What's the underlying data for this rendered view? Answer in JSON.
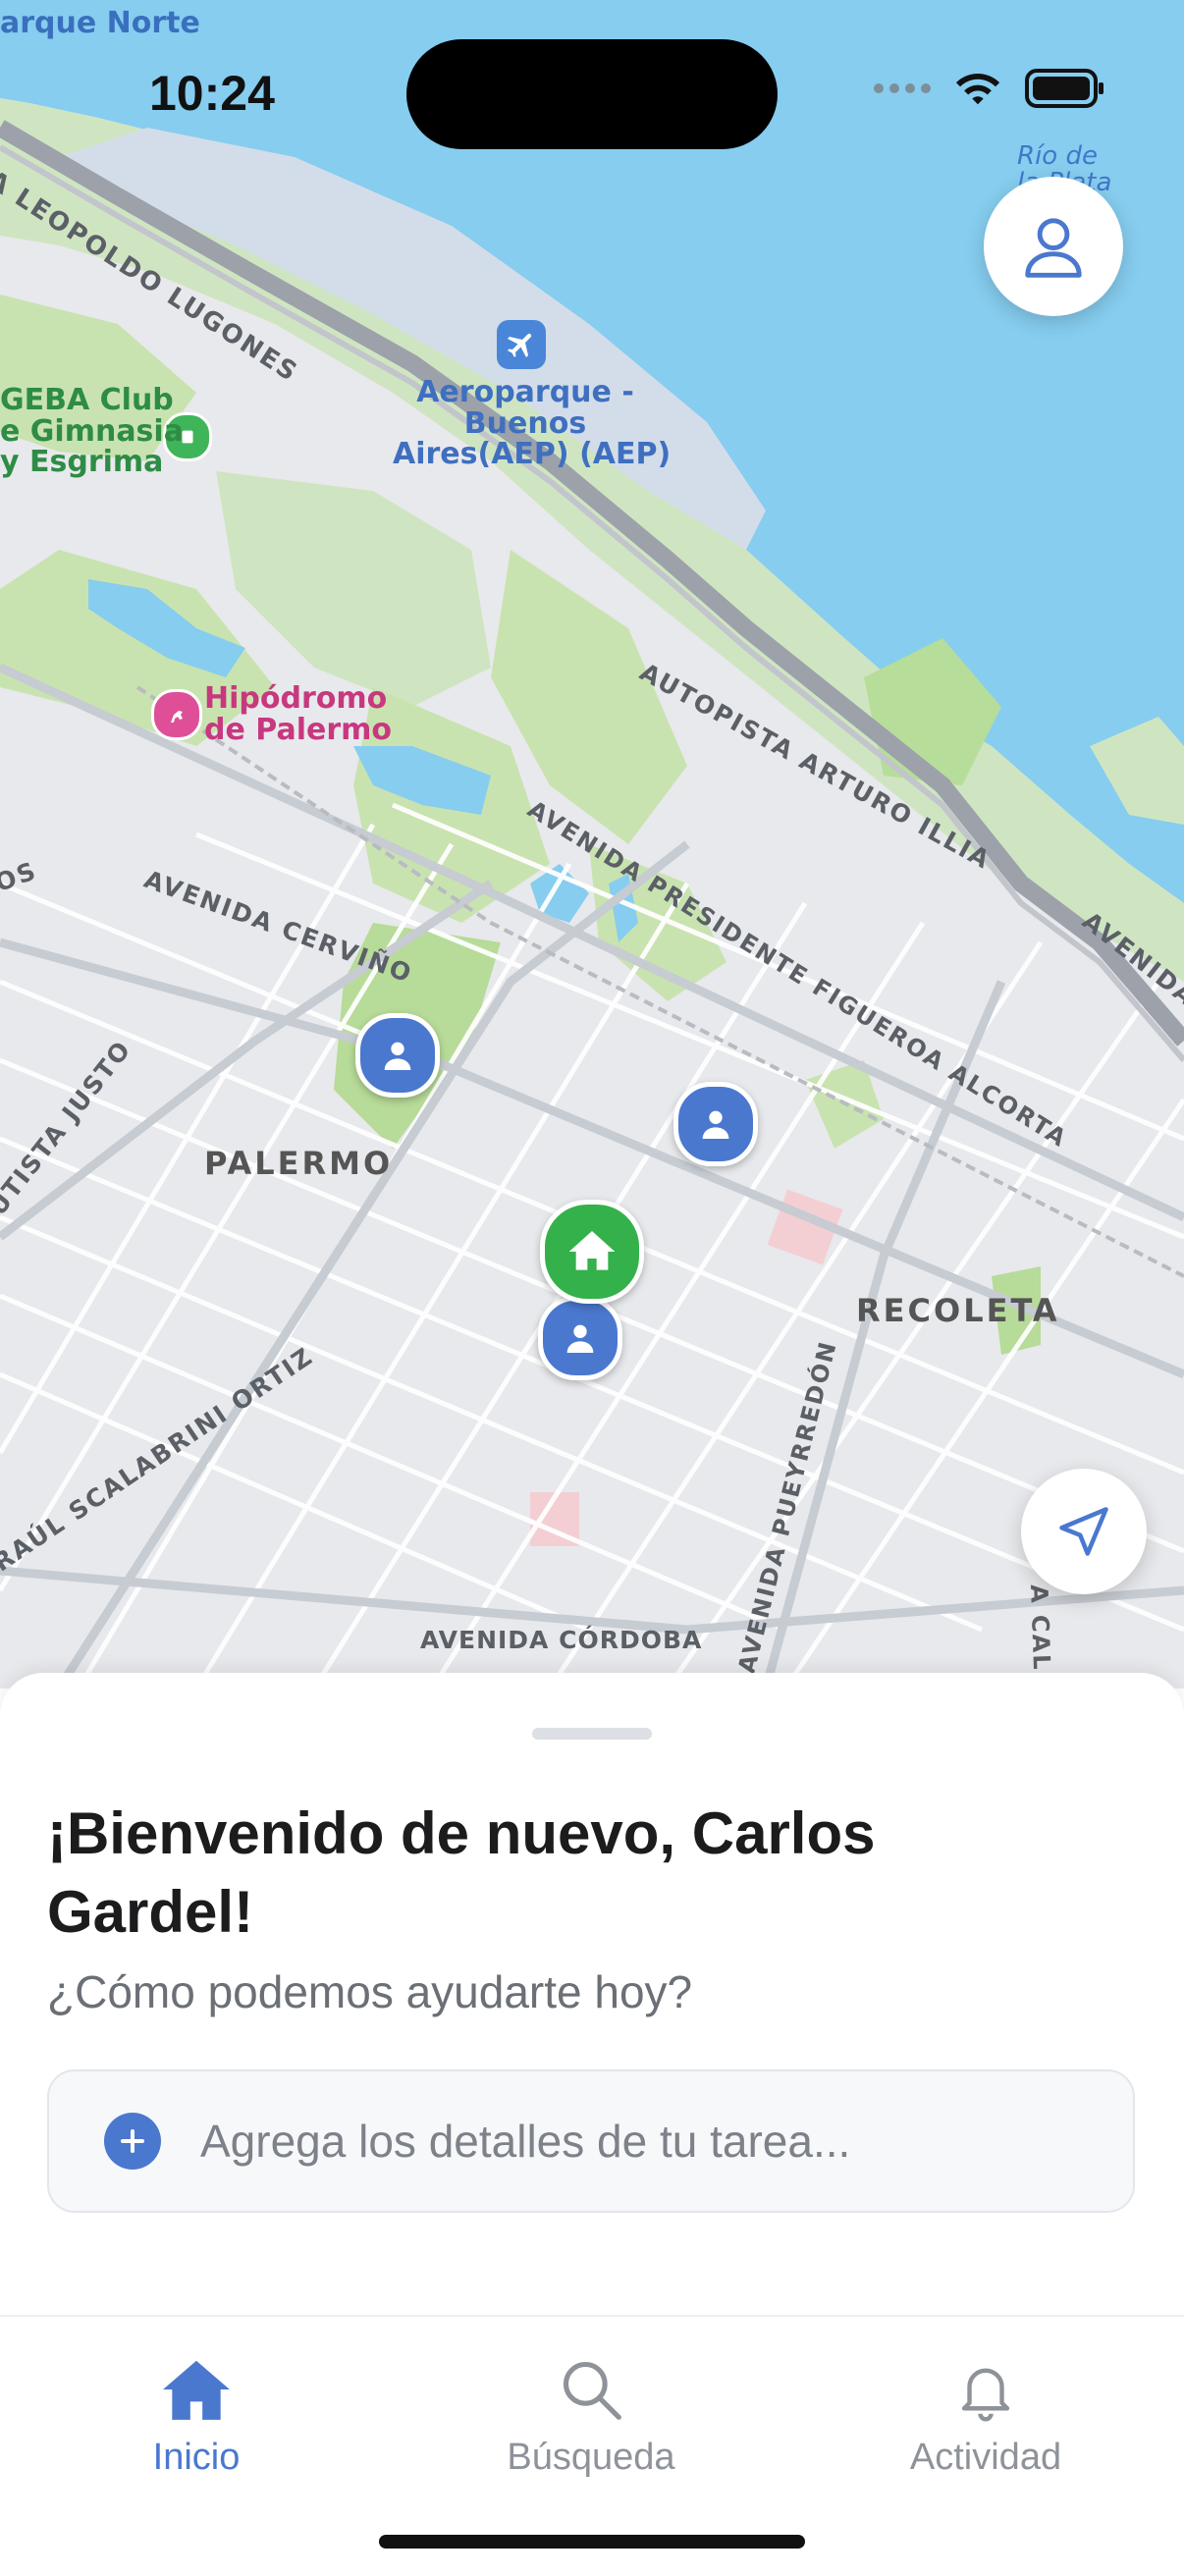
{
  "status_bar": {
    "time": "10:24"
  },
  "map": {
    "labels": {
      "parque_norte": "arque Norte",
      "rio_de_la_plata": "Río de",
      "rio_de_la_plata_2": "la Plata",
      "leopoldo_lugones": "A LEOPOLDO LUGONES",
      "aeroparque": "Aeroparque -",
      "aeroparque_2": "Buenos",
      "aeroparque_3": "Aires(AEP) (AEP)",
      "geba_1": "GEBA Club",
      "geba_2": "e Gimnasia",
      "geba_3": "y Esgrima",
      "hipodromo_1": "Hipódromo",
      "hipodromo_2": "de Palermo",
      "autopista_illia": "AUTOPISTA ARTURO ILLIA",
      "avenida_right": "AVENIDA",
      "figueroa_alcorta": "AVENIDA PRESIDENTE FIGUEROA ALCORTA",
      "cervino": "AVENIDA CERVIÑO",
      "os": "OS",
      "justo": "UTISTA JUSTO",
      "palermo": "PALERMO",
      "recoleta": "RECOLETA",
      "scalabrini": "RAÚL SCALABRINI ORTIZ",
      "pueyrredon": "AVENIDA PUEYRREDÓN",
      "cordoba": "AVENIDA CÓRDOBA",
      "a_call": "A CALL"
    }
  },
  "sheet": {
    "welcome": "¡Bienvenido de nuevo, Carlos Gardel!",
    "subtitle": "¿Cómo podemos ayudarte hoy?",
    "task_placeholder": "Agrega los detalles de tu tarea..."
  },
  "tabs": [
    {
      "label": "Inicio",
      "icon": "home-icon",
      "active": true
    },
    {
      "label": "Búsqueda",
      "icon": "search-icon",
      "active": false
    },
    {
      "label": "Actividad",
      "icon": "bell-icon",
      "active": false
    }
  ],
  "colors": {
    "accent": "#4a78cf",
    "home_pin": "#34b14a",
    "water": "#86cdef",
    "park": "#c9e3b0"
  }
}
